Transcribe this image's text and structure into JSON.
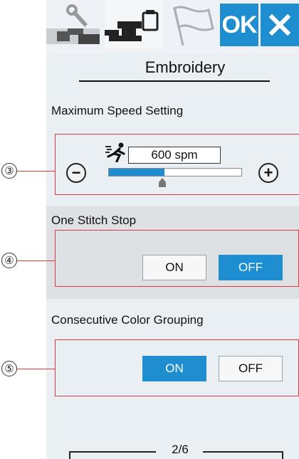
{
  "tabs": [
    {
      "name": "machine-settings",
      "icon": "wrench-icon",
      "active": false
    },
    {
      "name": "embroidery-settings",
      "icon": "embroidery-machine-icon",
      "active": true
    },
    {
      "name": "language-settings",
      "icon": "flag-icon",
      "active": false
    }
  ],
  "ok_label": "OK",
  "title": "Embroidery",
  "max_speed": {
    "label": "Maximum Speed Setting",
    "value": "600 spm",
    "level": 0.42,
    "callout": "③",
    "minus": "−",
    "plus": "+"
  },
  "one_stitch_stop": {
    "label": "One Stitch Stop",
    "callout": "④",
    "on_label": "ON",
    "off_label": "OFF",
    "selected": "OFF"
  },
  "color_grouping": {
    "label": "Consecutive Color Grouping",
    "callout": "⑤",
    "on_label": "ON",
    "off_label": "OFF",
    "selected": "ON"
  },
  "page": "2/6",
  "colors": {
    "accent": "#1f8ed0",
    "highlight": "#e03a3a"
  }
}
